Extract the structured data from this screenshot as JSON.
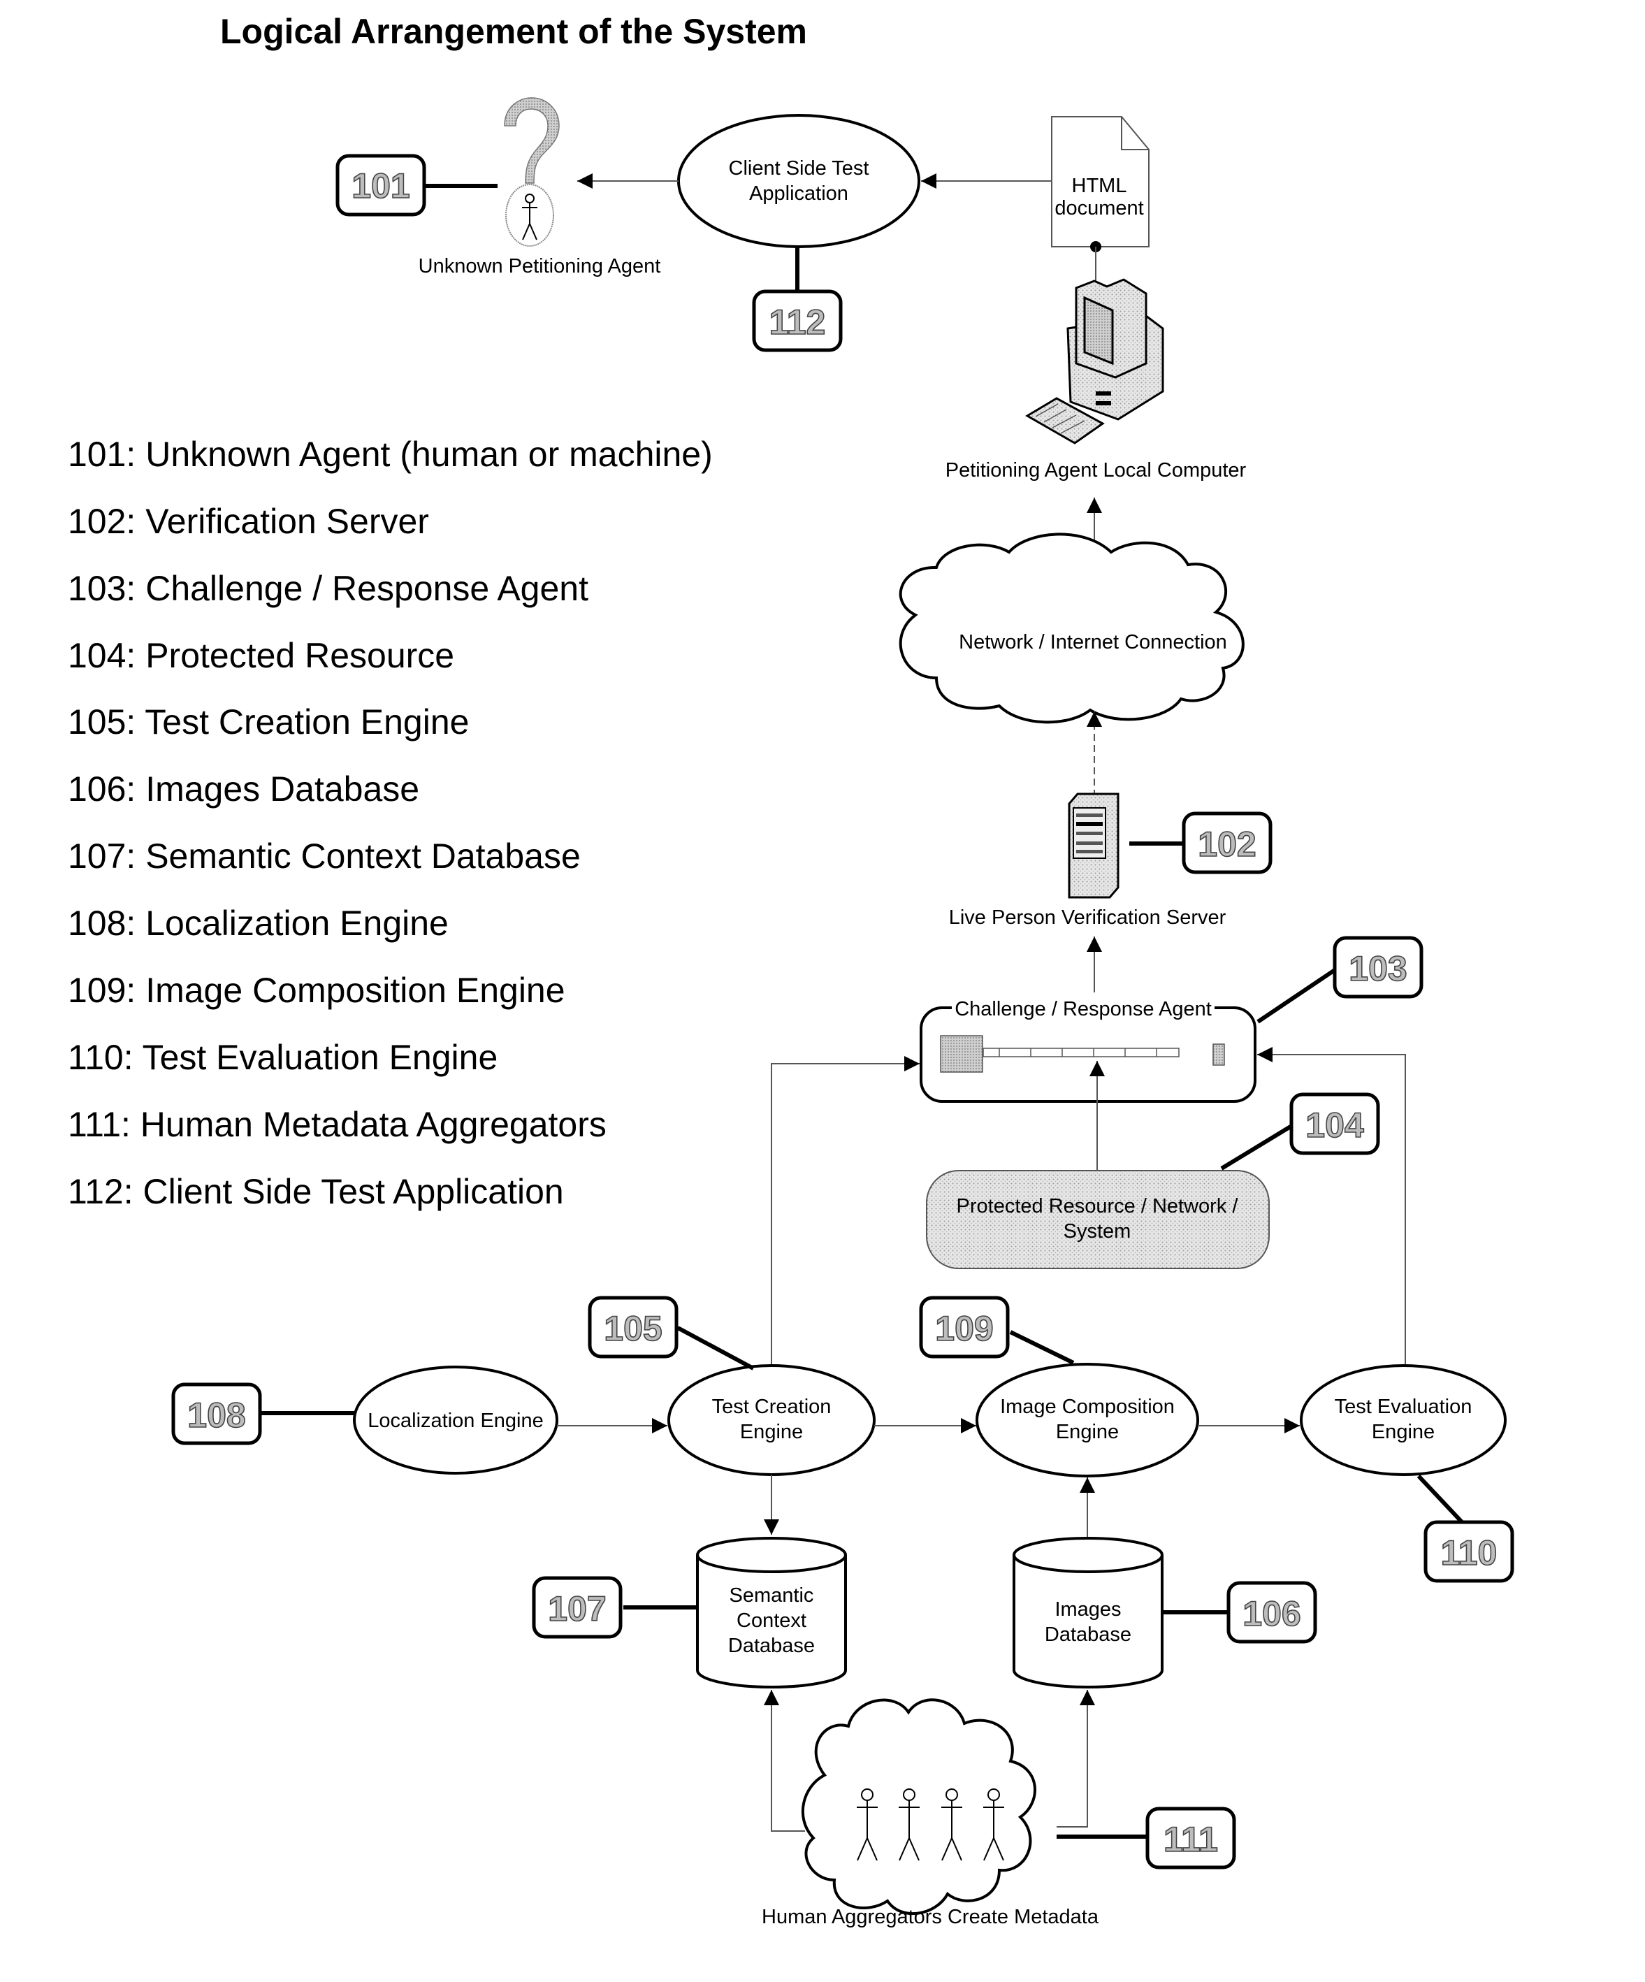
{
  "title": "Logical Arrangement of the System",
  "legend": [
    "101: Unknown Agent (human or machine)",
    "102: Verification Server",
    "103: Challenge / Response Agent",
    "104: Protected Resource",
    "105: Test Creation Engine",
    "106: Images Database",
    "107: Semantic Context Database",
    "108: Localization Engine",
    "109: Image Composition Engine",
    "110: Test Evaluation Engine",
    "111: Human Metadata Aggregators",
    "112: Client Side Test Application"
  ],
  "nodes": {
    "unknown_agent": "Unknown Petitioning Agent",
    "client_app": [
      "Client Side Test",
      "Application"
    ],
    "html_doc": [
      "HTML",
      "document"
    ],
    "local_computer": "Petitioning Agent Local Computer",
    "network": "Network / Internet Connection",
    "server": "Live Person Verification Server",
    "challenge": "Challenge / Response Agent",
    "protected": [
      "Protected Resource / Network /",
      "System"
    ],
    "localization": "Localization Engine",
    "test_creation": [
      "Test Creation",
      "Engine"
    ],
    "image_composition": [
      "Image Composition",
      "Engine"
    ],
    "test_evaluation": [
      "Test Evaluation",
      "Engine"
    ],
    "semantic_db": [
      "Semantic",
      "Context",
      "Database"
    ],
    "images_db": [
      "Images",
      "Database"
    ],
    "aggregators": "Human Aggregators Create Metadata"
  },
  "callouts": {
    "c101": "101",
    "c102": "102",
    "c103": "103",
    "c104": "104",
    "c105": "105",
    "c106": "106",
    "c107": "107",
    "c108": "108",
    "c109": "109",
    "c110": "110",
    "c111": "111",
    "c112": "112"
  },
  "edges": [
    {
      "from": "client_app",
      "to": "unknown_agent"
    },
    {
      "from": "html_doc",
      "to": "client_app"
    },
    {
      "from": "local_computer",
      "to": "html_doc"
    },
    {
      "from": "network",
      "to": "local_computer"
    },
    {
      "from": "server",
      "to": "network"
    },
    {
      "from": "challenge",
      "to": "server"
    },
    {
      "from": "protected",
      "to": "challenge"
    },
    {
      "from": "test_creation",
      "to": "challenge"
    },
    {
      "from": "test_evaluation",
      "to": "challenge"
    },
    {
      "from": "localization",
      "to": "test_creation"
    },
    {
      "from": "test_creation",
      "to": "image_composition"
    },
    {
      "from": "image_composition",
      "to": "test_evaluation"
    },
    {
      "from": "test_creation",
      "to": "semantic_db"
    },
    {
      "from": "images_db",
      "to": "image_composition"
    },
    {
      "from": "aggregators",
      "to": "semantic_db"
    },
    {
      "from": "aggregators",
      "to": "images_db"
    }
  ]
}
